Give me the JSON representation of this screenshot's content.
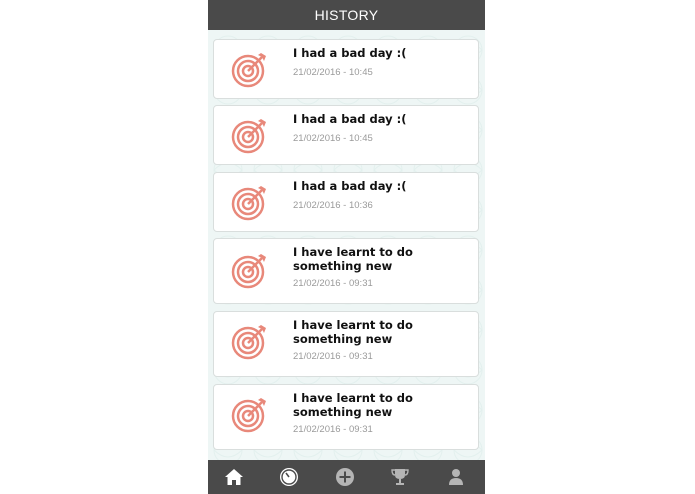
{
  "header": {
    "title": "HISTORY"
  },
  "history": [
    {
      "title": "I had a bad day :(",
      "time": "21/02/2016 - 10:45"
    },
    {
      "title": "I had a bad day :(",
      "time": "21/02/2016 - 10:45"
    },
    {
      "title": "I had a bad day :(",
      "time": "21/02/2016 - 10:36"
    },
    {
      "title": "I have learnt to do something new",
      "time": "21/02/2016 - 09:31"
    },
    {
      "title": "I have learnt to do something new",
      "time": "21/02/2016 - 09:31"
    },
    {
      "title": "I have learnt to do something new",
      "time": "21/02/2016 - 09:31"
    }
  ],
  "entry_icon": "target-arrow-icon",
  "tabs": [
    {
      "icon": "home-icon",
      "active": false
    },
    {
      "icon": "timer-icon",
      "active": true
    },
    {
      "icon": "add-icon",
      "active": false
    },
    {
      "icon": "trophy-icon",
      "active": false
    },
    {
      "icon": "user-icon",
      "active": false
    }
  ],
  "colors": {
    "header_bg": "#4a4a4a",
    "accent": "#e8887a",
    "background": "#eef6f5"
  }
}
